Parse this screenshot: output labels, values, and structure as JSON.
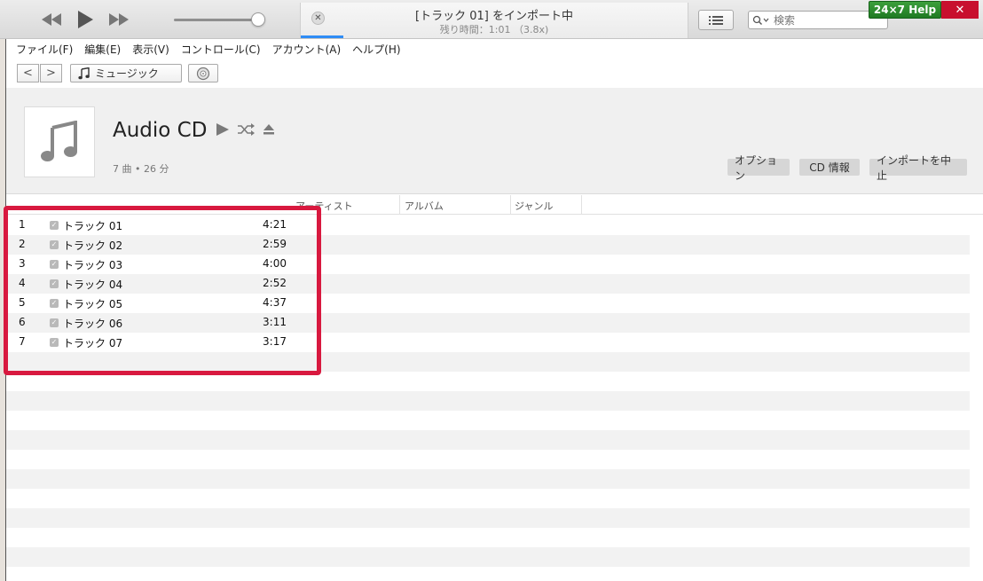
{
  "lcd": {
    "title": "[トラック 01] をインポート中",
    "subtitle": "残り時間：1:01 （3.8x)",
    "progress": 0.11
  },
  "search": {
    "placeholder": "検索"
  },
  "help_badge": "24×7 Help",
  "close_glyph": "✕",
  "menu": [
    "ファイル(F)",
    "編集(E)",
    "表示(V)",
    "コントロール(C)",
    "アカウント(A)",
    "ヘルプ(H)"
  ],
  "nav": {
    "back": "<",
    "forward": ">",
    "source_label": "ミュージック"
  },
  "album": {
    "title": "Audio CD",
    "meta": "7 曲 • 26 分",
    "buttons": {
      "options": "オプション",
      "cd_info": "CD 情報",
      "stop_import": "インポートを中止"
    }
  },
  "columns": {
    "artist": "アーティスト",
    "album": "アルバム",
    "genre": "ジャンル"
  },
  "tracks": [
    {
      "num": "1",
      "name": "トラック 01",
      "time": "4:21"
    },
    {
      "num": "2",
      "name": "トラック 02",
      "time": "2:59"
    },
    {
      "num": "3",
      "name": "トラック 03",
      "time": "4:00"
    },
    {
      "num": "4",
      "name": "トラック 04",
      "time": "2:52"
    },
    {
      "num": "5",
      "name": "トラック 05",
      "time": "4:37"
    },
    {
      "num": "6",
      "name": "トラック 06",
      "time": "3:11"
    },
    {
      "num": "7",
      "name": "トラック 07",
      "time": "3:17"
    }
  ],
  "colors": {
    "accent": "#2f8df5",
    "highlight": "#d8193f",
    "help_green": "#2a8c2d",
    "close_red": "#c8102e"
  }
}
